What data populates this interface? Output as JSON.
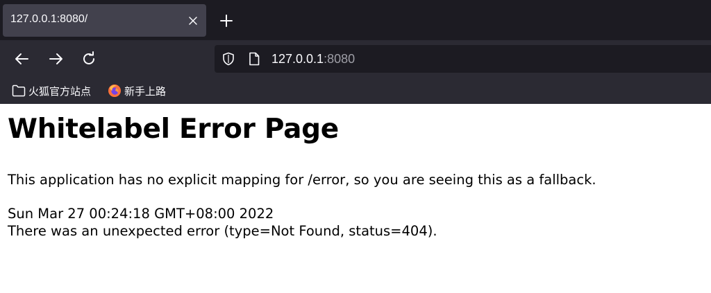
{
  "tab": {
    "title": "127.0.0.1:8080/"
  },
  "urlbar": {
    "host": "127.0.0.1",
    "port": ":8080"
  },
  "bookmarks": [
    {
      "label": "火狐官方站点",
      "icon": "folder-icon"
    },
    {
      "label": "新手上路",
      "icon": "firefox-icon"
    }
  ],
  "page": {
    "heading": "Whitelabel Error Page",
    "message": "This application has no explicit mapping for /error, so you are seeing this as a fallback.",
    "timestamp": "Sun Mar 27 00:24:18 GMT+08:00 2022",
    "error": "There was an unexpected error (type=Not Found, status=404)."
  },
  "colors": {
    "chrome_dark": "#1c1b22",
    "toolbar": "#2b2a33",
    "tab_active": "#42414d",
    "text_light": "#fbfbfe",
    "text_muted": "#9e9ea6"
  }
}
